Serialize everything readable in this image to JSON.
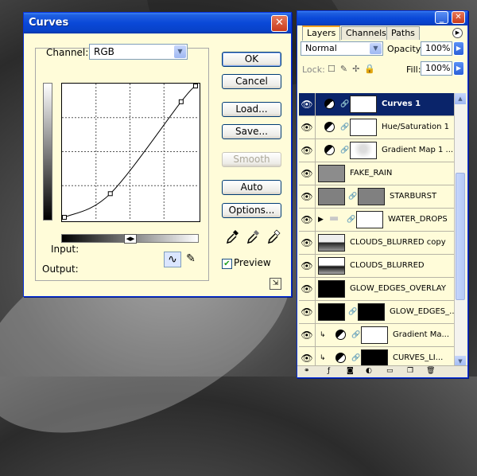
{
  "curves": {
    "title": "Curves",
    "close": "✕",
    "channel_label": "Channel:",
    "channel_value": "RGB",
    "input_label": "Input:",
    "output_label": "Output:",
    "buttons": {
      "ok": "OK",
      "cancel": "Cancel",
      "load": "Load...",
      "save": "Save...",
      "smooth": "Smooth",
      "auto": "Auto",
      "options": "Options..."
    },
    "preview_label": "Preview",
    "preview_checked": true,
    "curve_points": [
      [
        0,
        0
      ],
      [
        0.35,
        0.18
      ],
      [
        0.89,
        0.88
      ],
      [
        1,
        1
      ]
    ]
  },
  "layers": {
    "tabs": [
      "Layers",
      "Channels",
      "Paths"
    ],
    "blend_mode": "Normal",
    "opacity_label": "Opacity:",
    "opacity_value": "100%",
    "lock_label": "Lock:",
    "fill_label": "Fill:",
    "fill_value": "100%",
    "items": [
      {
        "name": "Curves 1",
        "type": "adjustment",
        "selected": true
      },
      {
        "name": "Hue/Saturation 1",
        "type": "adjustment",
        "selected": false
      },
      {
        "name": "Gradient Map 1 ...",
        "type": "adjustment",
        "selected": false
      },
      {
        "name": "FAKE_RAIN",
        "type": "layer",
        "selected": false
      },
      {
        "name": "STARBURST",
        "type": "layer",
        "selected": false
      },
      {
        "name": "WATER_DROPS",
        "type": "group",
        "selected": false
      },
      {
        "name": "CLOUDS_BLURRED copy",
        "type": "layer",
        "selected": false
      },
      {
        "name": "CLOUDS_BLURRED",
        "type": "layer",
        "selected": false
      },
      {
        "name": "GLOW_EDGES_OVERLAY",
        "type": "layer",
        "selected": false
      },
      {
        "name": "GLOW_EDGES_...",
        "type": "layer",
        "selected": false
      },
      {
        "name": "Gradient Ma...",
        "type": "clipped",
        "selected": false
      },
      {
        "name": "CURVES_LI...",
        "type": "clipped",
        "selected": false
      }
    ]
  }
}
